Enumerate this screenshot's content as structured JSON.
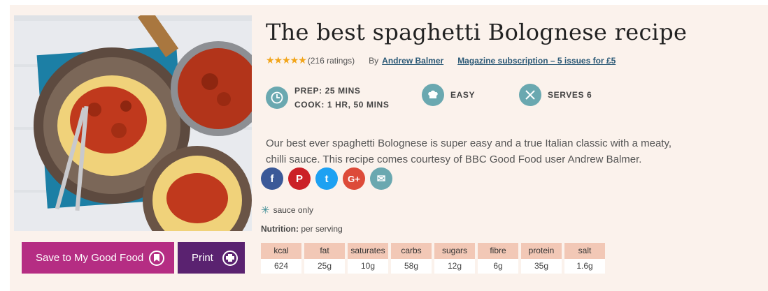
{
  "recipe": {
    "title": "The best spaghetti Bolognese recipe",
    "rating_stars": "★★★★★",
    "ratings_count": "(216 ratings)",
    "by_label": "By",
    "author": "Andrew Balmer",
    "promo_link": "Magazine subscription – 5 issues for £5"
  },
  "times": {
    "prep": "PREP: 25 MINS",
    "cook": "COOK: 1 HR, 50 MINS",
    "difficulty": "EASY",
    "serves": "SERVES 6"
  },
  "description": "Our best ever spaghetti Bolognese is super easy and a true Italian classic with a meaty, chilli sauce. This recipe comes courtesy of BBC Good Food user Andrew Balmer.",
  "social": {
    "facebook": "f",
    "pinterest": "P",
    "twitter": "t",
    "googleplus": "G+",
    "email": "✉"
  },
  "freezable": "sauce only",
  "nutrition": {
    "label": "Nutrition:",
    "basis": "per serving",
    "items": [
      {
        "name": "kcal",
        "value": "624"
      },
      {
        "name": "fat",
        "value": "25g"
      },
      {
        "name": "saturates",
        "value": "10g"
      },
      {
        "name": "carbs",
        "value": "58g"
      },
      {
        "name": "sugars",
        "value": "12g"
      },
      {
        "name": "fibre",
        "value": "6g"
      },
      {
        "name": "protein",
        "value": "35g"
      },
      {
        "name": "salt",
        "value": "1.6g"
      }
    ]
  },
  "buttons": {
    "save": "Save to My Good Food",
    "print": "Print"
  },
  "colors": {
    "accent_magenta": "#b52d83",
    "accent_purple": "#5a2270",
    "teal": "#6aa8b0",
    "facebook": "#3b5998",
    "pinterest": "#cb2027",
    "twitter": "#1da1f2",
    "googleplus": "#dd4b39",
    "email": "#6aa8b0"
  }
}
